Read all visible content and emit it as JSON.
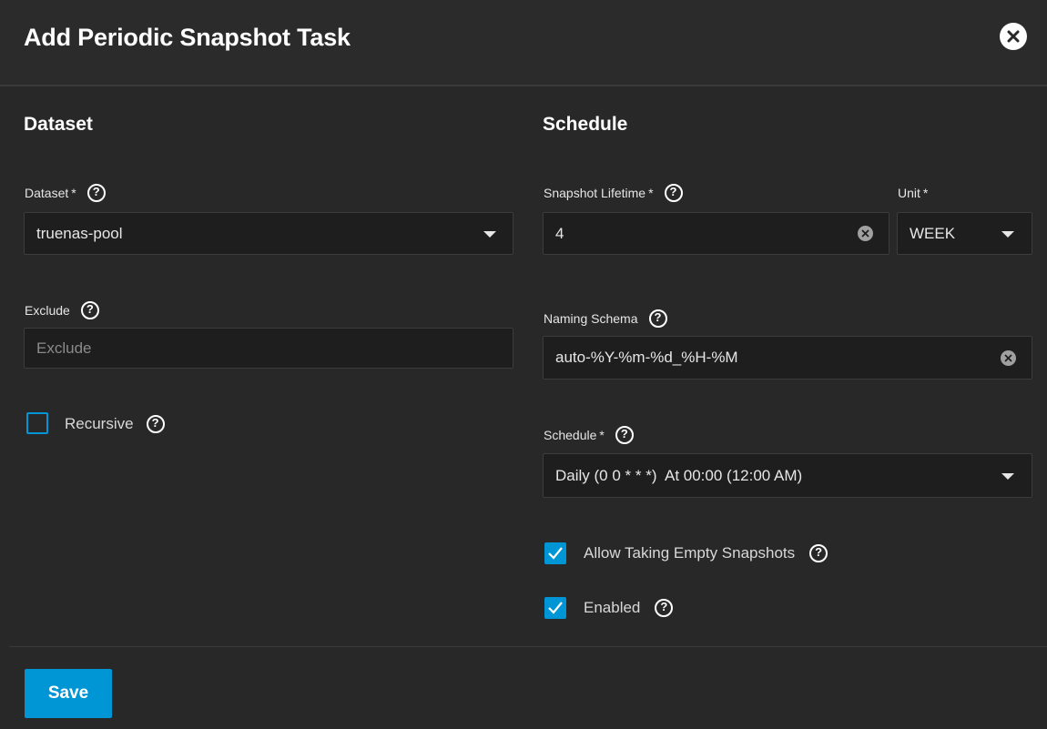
{
  "dialog": {
    "title": "Add Periodic Snapshot Task"
  },
  "icons": {
    "close": "close-icon",
    "help": "help-circle-icon",
    "clear": "clear-icon",
    "dropdown": "caret-down-icon",
    "check": "check-icon"
  },
  "dataset_section": {
    "heading": "Dataset",
    "dataset": {
      "label": "Dataset",
      "required_mark": "*",
      "value": "truenas-pool"
    },
    "exclude": {
      "label": "Exclude",
      "value": "",
      "placeholder": "Exclude"
    },
    "recursive": {
      "label": "Recursive",
      "checked": false
    }
  },
  "schedule_section": {
    "heading": "Schedule",
    "lifetime": {
      "label": "Snapshot Lifetime",
      "required_mark": "*",
      "value": "4"
    },
    "unit": {
      "label": "Unit",
      "required_mark": "*",
      "value": "WEEK"
    },
    "naming_schema": {
      "label": "Naming Schema",
      "value": "auto-%Y-%m-%d_%H-%M"
    },
    "schedule": {
      "label": "Schedule",
      "required_mark": "*",
      "value": "Daily (0 0 * * *)  At 00:00 (12:00 AM)"
    },
    "allow_empty": {
      "label": "Allow Taking Empty Snapshots",
      "checked": true
    },
    "enabled": {
      "label": "Enabled",
      "checked": true
    }
  },
  "footer": {
    "save_label": "Save"
  },
  "colors": {
    "accent": "#0095d5",
    "background": "#282828",
    "field": "#1e1e1e"
  }
}
